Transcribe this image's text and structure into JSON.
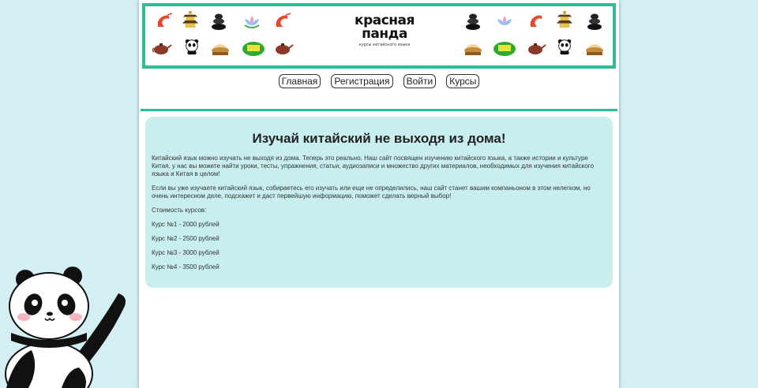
{
  "logo": {
    "line1": "красная",
    "line2": "панда",
    "tagline": "курсы китайского языка"
  },
  "nav": {
    "items": [
      "Главная",
      "Регистрация",
      "Войти",
      "Курсы"
    ]
  },
  "content": {
    "title": "Изучай китайский не выходя из дома!",
    "paragraph1": "Китайский язык можно изучать не выходя из дома. Теперь это реально. Наш сайт посвящен изучению китайского языка, а также истории и культуре Китая, у нас вы можете найти уроки, тесты, упражнения, статьи, аудиозаписи и множество других материалов, необходимых для изучения китайского языка и Китая в целом!",
    "paragraph2": "Если вы уже изучаете китайский язык, собираетесь его изучать или еще не определились, наш сайт станет вашим компаньоном в этом нелегком, но очень интересном деле, подскажет и даст первейшую информацию, поможет сделать верный выбор!",
    "prices_heading": "Стоимость курсов:",
    "courses": [
      "Курс №1 - 2000 рублей",
      "Курс №2 - 2500 рублей",
      "Курс №3 - 3000 рублей",
      "Курс №4 - 3500 рублей"
    ]
  },
  "icons": {
    "banner_left": [
      "shrimp-icon",
      "pagoda-icon",
      "stones-icon",
      "lotus-icon",
      "shrimp-icon",
      "teapot-icon",
      "panda-icon",
      "dumplings-icon",
      "money-icon",
      "teapot-icon"
    ],
    "banner_right": [
      "stones-icon",
      "lotus-icon",
      "shrimp-icon",
      "pagoda-icon",
      "stones-icon",
      "dumplings-icon",
      "money-icon",
      "teapot-icon",
      "panda-icon",
      "dumplings-icon"
    ],
    "mascot": "panda-mascot-icon"
  },
  "colors": {
    "background": "#d3eff3",
    "accent": "#33bb99",
    "content_bg": "#c8eef0"
  }
}
